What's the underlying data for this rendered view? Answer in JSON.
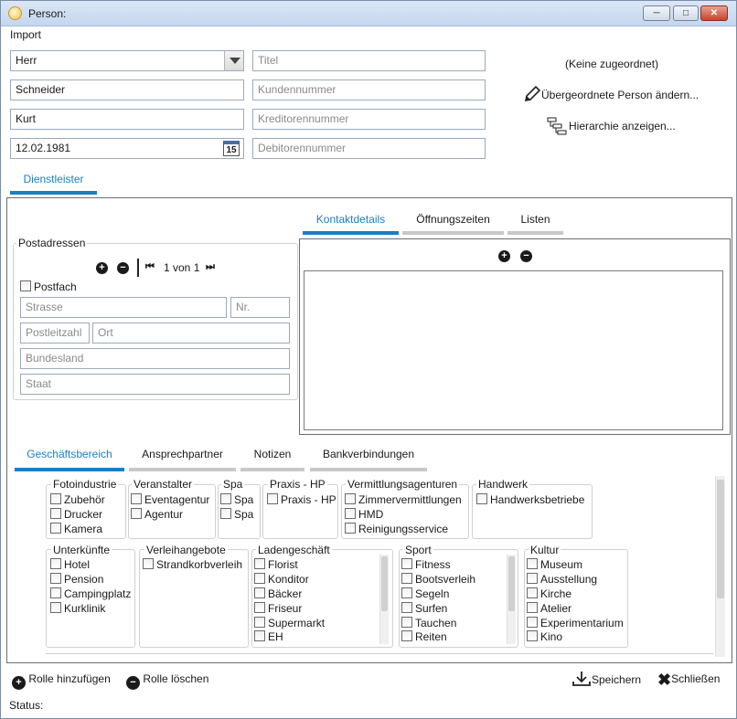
{
  "window": {
    "title": "Person:"
  },
  "menu": {
    "import": "Import"
  },
  "person": {
    "anrede": "Herr",
    "nachname": "Schneider",
    "vorname": "Kurt",
    "geburtsdatum": "12.02.1981",
    "calendar_day": "15",
    "titel_placeholder": "Titel",
    "kundennummer_placeholder": "Kundennummer",
    "kreditorennummer_placeholder": "Kreditorennummer",
    "debitorennummer_placeholder": "Debitorennummer"
  },
  "parent": {
    "status": "(Keine zugeordnet)",
    "change_label": "Übergeordnete Person ändern...",
    "hierarchy_label": "Hierarchie anzeigen..."
  },
  "role_tabs": [
    "Dienstleister"
  ],
  "address": {
    "title": "Postadressen",
    "pager": "1 von 1",
    "postfach": "Postfach",
    "strasse": "Strasse",
    "nr": "Nr.",
    "plz": "Postleitzahl",
    "ort": "Ort",
    "bundesland": "Bundesland",
    "staat": "Staat"
  },
  "contact_tabs": [
    "Kontaktdetails",
    "Öffnungszeiten",
    "Listen"
  ],
  "business_tabs": [
    "Geschäftsbereich",
    "Ansprechpartner",
    "Notizen",
    "Bankverbindungen"
  ],
  "groups": [
    {
      "title": "Fotoindustrie",
      "items": [
        "Zubehör",
        "Drucker",
        "Kamera"
      ]
    },
    {
      "title": "Veranstalter",
      "items": [
        "Eventagentur",
        "Agentur"
      ]
    },
    {
      "title": "Spa",
      "items": [
        "Spa",
        "Spa"
      ]
    },
    {
      "title": "Praxis - HP",
      "items": [
        "Praxis - HP"
      ]
    },
    {
      "title": "Vermittlungsagenturen",
      "items": [
        "Zimmervermittlungen",
        "HMD",
        "Reinigungsservice"
      ]
    },
    {
      "title": "Handwerk",
      "items": [
        "Handwerksbetriebe"
      ]
    },
    {
      "title": "Unterkünfte",
      "items": [
        "Hotel",
        "Pension",
        "Campingplatz",
        "Kurklinik"
      ]
    },
    {
      "title": "Verleihangebote",
      "items": [
        "Strandkorbverleih"
      ]
    },
    {
      "title": "Ladengeschäft",
      "items": [
        "Florist",
        "Konditor",
        "Bäcker",
        "Friseur",
        "Supermarkt",
        "EH"
      ]
    },
    {
      "title": "Sport",
      "items": [
        "Fitness",
        "Bootsverleih",
        "Segeln",
        "Surfen",
        "Tauchen",
        "Reiten"
      ]
    },
    {
      "title": "Kultur",
      "items": [
        "Museum",
        "Ausstellung",
        "Kirche",
        "Atelier",
        "Experimentarium",
        "Kino"
      ]
    }
  ],
  "footer": {
    "add_role": "Rolle hinzufügen",
    "delete_role": "Rolle löschen",
    "save": "Speichern",
    "close": "Schließen",
    "status": "Status:"
  },
  "colors": {
    "accent": "#1a7fc1",
    "tab_inactive": "#c8c8c8"
  }
}
